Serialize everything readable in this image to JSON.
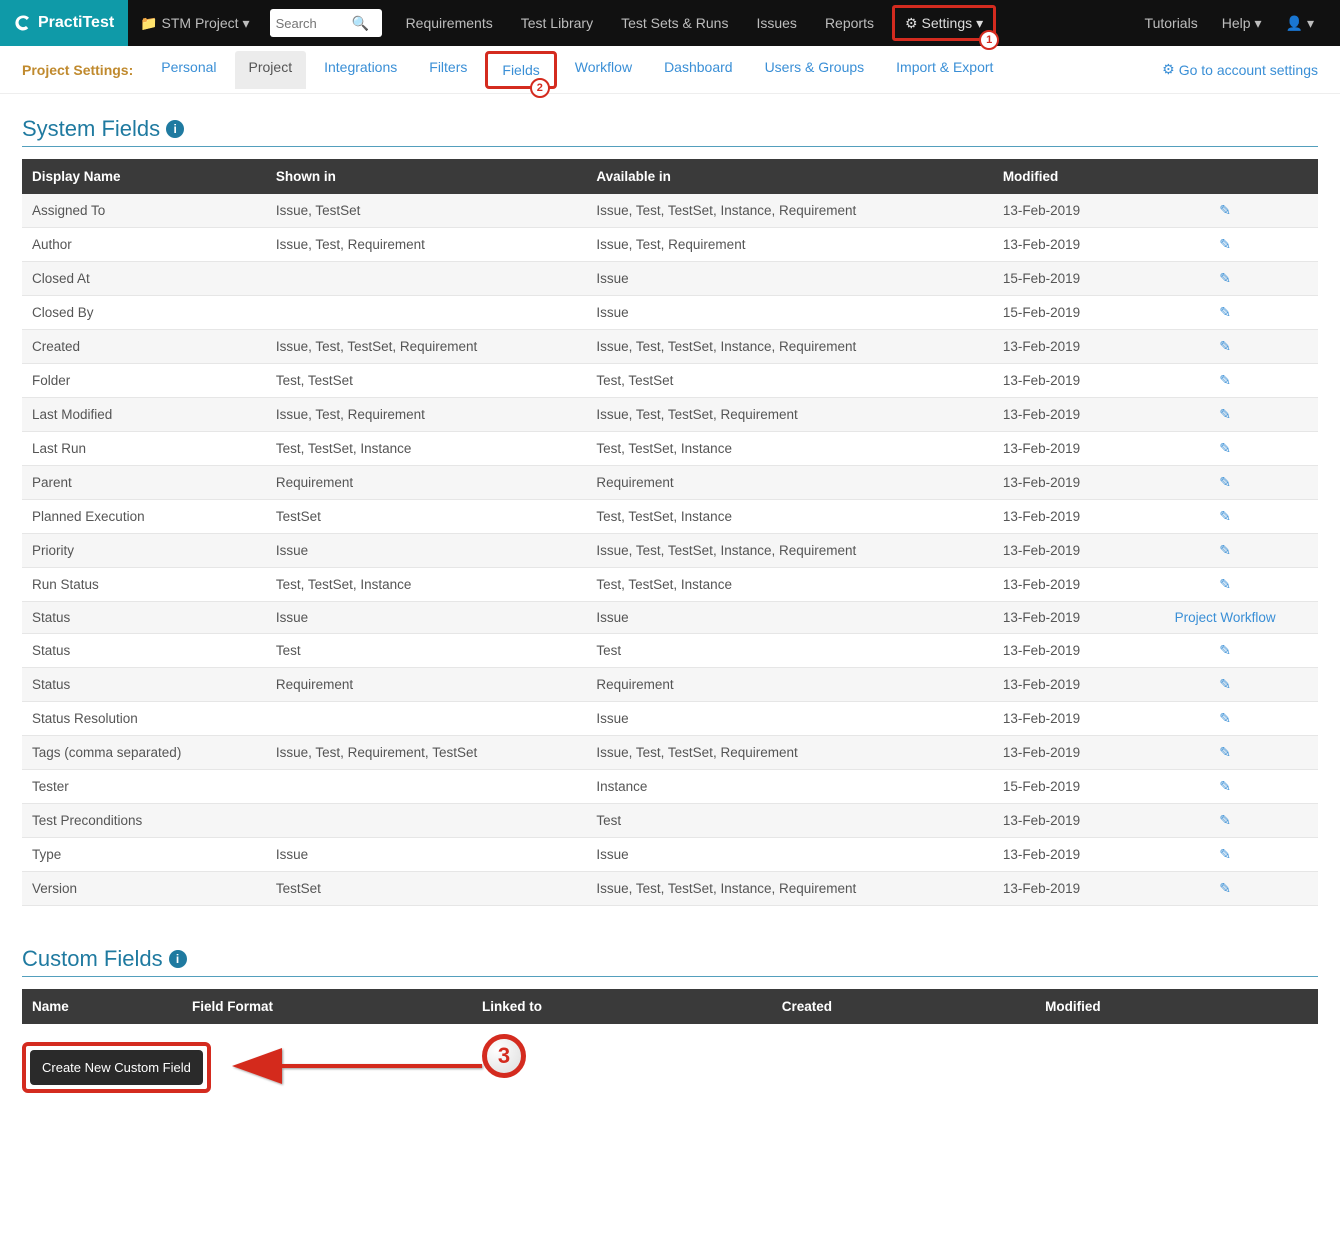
{
  "brand": {
    "name": "PractiTest"
  },
  "navbar": {
    "project_label": "STM Project",
    "search_placeholder": "Search",
    "items": [
      "Requirements",
      "Test Library",
      "Test Sets & Runs",
      "Issues",
      "Reports"
    ],
    "settings_label": "Settings",
    "right": {
      "tutorials": "Tutorials",
      "help": "Help"
    }
  },
  "annotations": {
    "settings_badge": "1",
    "fields_badge": "2",
    "create_badge": "3"
  },
  "subnav": {
    "label": "Project Settings:",
    "tabs": [
      "Personal",
      "Project",
      "Integrations",
      "Filters",
      "Fields",
      "Workflow",
      "Dashboard",
      "Users & Groups",
      "Import & Export"
    ],
    "active_index": 1,
    "highlight_index": 4,
    "account_link": "Go to account settings"
  },
  "system_fields": {
    "title": "System Fields",
    "headers": [
      "Display Name",
      "Shown in",
      "Available in",
      "Modified",
      ""
    ],
    "rows": [
      {
        "name": "Assigned To",
        "shown": "Issue, TestSet",
        "avail": "Issue, Test, TestSet, Instance, Requirement",
        "mod": "13-Feb-2019",
        "action": "edit"
      },
      {
        "name": "Author",
        "shown": "Issue, Test, Requirement",
        "avail": "Issue, Test, Requirement",
        "mod": "13-Feb-2019",
        "action": "edit"
      },
      {
        "name": "Closed At",
        "shown": "",
        "avail": "Issue",
        "mod": "15-Feb-2019",
        "action": "edit"
      },
      {
        "name": "Closed By",
        "shown": "",
        "avail": "Issue",
        "mod": "15-Feb-2019",
        "action": "edit"
      },
      {
        "name": "Created",
        "shown": "Issue, Test, TestSet, Requirement",
        "avail": "Issue, Test, TestSet, Instance, Requirement",
        "mod": "13-Feb-2019",
        "action": "edit"
      },
      {
        "name": "Folder",
        "shown": "Test, TestSet",
        "avail": "Test, TestSet",
        "mod": "13-Feb-2019",
        "action": "edit"
      },
      {
        "name": "Last Modified",
        "shown": "Issue, Test, Requirement",
        "avail": "Issue, Test, TestSet, Requirement",
        "mod": "13-Feb-2019",
        "action": "edit"
      },
      {
        "name": "Last Run",
        "shown": "Test, TestSet, Instance",
        "avail": "Test, TestSet, Instance",
        "mod": "13-Feb-2019",
        "action": "edit"
      },
      {
        "name": "Parent",
        "shown": "Requirement",
        "avail": "Requirement",
        "mod": "13-Feb-2019",
        "action": "edit"
      },
      {
        "name": "Planned Execution",
        "shown": "TestSet",
        "avail": "Test, TestSet, Instance",
        "mod": "13-Feb-2019",
        "action": "edit"
      },
      {
        "name": "Priority",
        "shown": "Issue",
        "avail": "Issue, Test, TestSet, Instance, Requirement",
        "mod": "13-Feb-2019",
        "action": "edit"
      },
      {
        "name": "Run Status",
        "shown": "Test, TestSet, Instance",
        "avail": "Test, TestSet, Instance",
        "mod": "13-Feb-2019",
        "action": "edit"
      },
      {
        "name": "Status",
        "shown": "Issue",
        "avail": "Issue",
        "mod": "13-Feb-2019",
        "action": "link",
        "action_label": "Project Workflow"
      },
      {
        "name": "Status",
        "shown": "Test",
        "avail": "Test",
        "mod": "13-Feb-2019",
        "action": "edit"
      },
      {
        "name": "Status",
        "shown": "Requirement",
        "avail": "Requirement",
        "mod": "13-Feb-2019",
        "action": "edit"
      },
      {
        "name": "Status Resolution",
        "shown": "",
        "avail": "Issue",
        "mod": "13-Feb-2019",
        "action": "edit"
      },
      {
        "name": "Tags (comma separated)",
        "shown": "Issue, Test, Requirement, TestSet",
        "avail": "Issue, Test, TestSet, Requirement",
        "mod": "13-Feb-2019",
        "action": "edit"
      },
      {
        "name": "Tester",
        "shown": "",
        "avail": "Instance",
        "mod": "15-Feb-2019",
        "action": "edit"
      },
      {
        "name": "Test Preconditions",
        "shown": "",
        "avail": "Test",
        "mod": "13-Feb-2019",
        "action": "edit"
      },
      {
        "name": "Type",
        "shown": "Issue",
        "avail": "Issue",
        "mod": "13-Feb-2019",
        "action": "edit"
      },
      {
        "name": "Version",
        "shown": "TestSet",
        "avail": "Issue, Test, TestSet, Instance, Requirement",
        "mod": "13-Feb-2019",
        "action": "edit"
      }
    ]
  },
  "custom_fields": {
    "title": "Custom Fields",
    "headers": [
      "Name",
      "Field Format",
      "Linked to",
      "Created",
      "Modified"
    ],
    "create_label": "Create New Custom Field"
  }
}
